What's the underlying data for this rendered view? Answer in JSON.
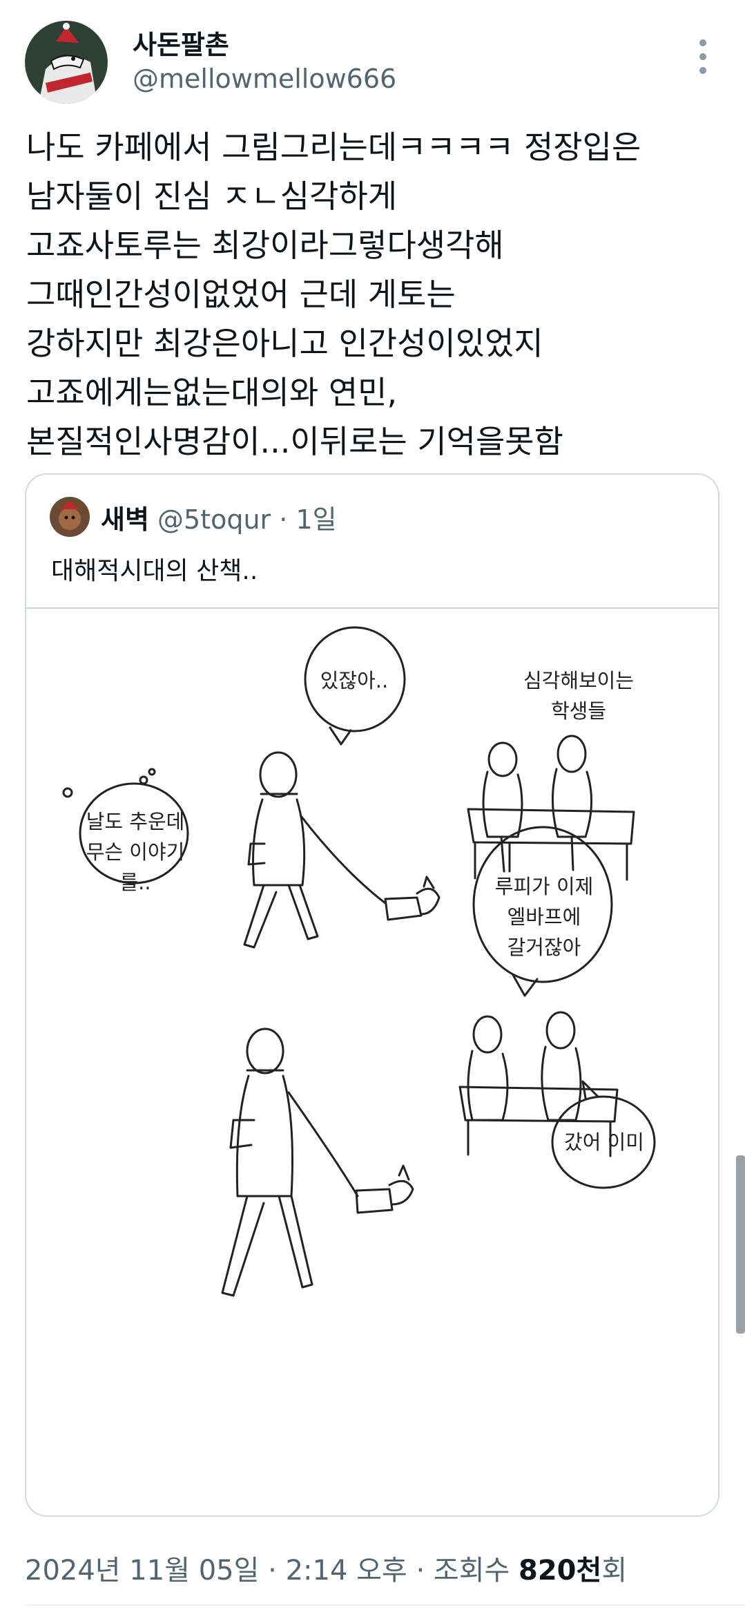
{
  "author": {
    "display_name": "사돈팔촌",
    "handle": "@mellowmellow666"
  },
  "tweet": {
    "text": "나도 카페에서 그림그리는데ㅋㅋㅋㅋ 정장입은\n남자둘이 진심 ㅈㄴ심각하게\n고죠사토루는 최강이라그렇다생각해\n그때인간성이없었어 근데 게토는\n강하지만 최강은아니고 인간성이있었지\n고죠에게는없는대의와 연민,\n본질적인사명감이...이뒤로는 기억을못함"
  },
  "quoted_tweet": {
    "display_name": "새벽",
    "handle": "@5toqur",
    "separator": "·",
    "time": "1일",
    "text": "대해적시대의 산책.."
  },
  "comic": {
    "bubbles": [
      {
        "text": "있잖아.."
      },
      {
        "text": "심각해보이는\n학생들"
      },
      {
        "text": "날도 추운데\n무슨 이야기를.."
      },
      {
        "text": "루피가 이제\n엘바프에\n갈거잖아"
      },
      {
        "text": "갔어 이미"
      }
    ]
  },
  "footer": {
    "date": "2024년 11월 05일",
    "sep1": "·",
    "time": "2:14 오후",
    "sep2": "·",
    "views_label": "조회수",
    "views_value": "820천",
    "views_suffix": "회"
  },
  "icons": {
    "more": "more-vertical-icon"
  }
}
